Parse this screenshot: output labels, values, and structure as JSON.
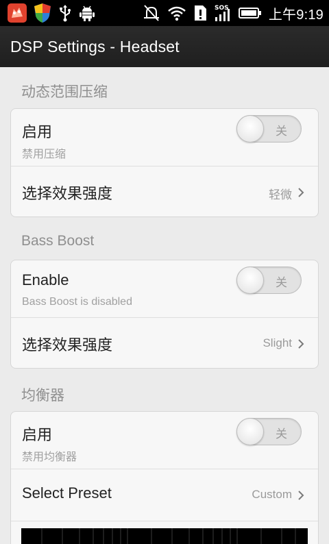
{
  "status_bar": {
    "time": "上午9:19",
    "icons": [
      "app-icon",
      "shield-icon",
      "usb-icon",
      "android-debug-icon",
      "vibrate-off-icon",
      "wifi-icon",
      "alert-icon",
      "sos-signal-icon",
      "battery-icon"
    ]
  },
  "title_bar": {
    "title": "DSP Settings - Headset"
  },
  "sections": [
    {
      "header": "动态范围压缩",
      "toggle_row": {
        "title": "启用",
        "subtitle": "禁用压缩",
        "toggle_label": "关",
        "toggle_on": false
      },
      "select_row": {
        "title": "选择效果强度",
        "value": "轻微"
      }
    },
    {
      "header": "Bass Boost",
      "toggle_row": {
        "title": "Enable",
        "subtitle": "Bass Boost is disabled",
        "toggle_label": "关",
        "toggle_on": false
      },
      "select_row": {
        "title": "选择效果强度",
        "value": "Slight"
      }
    },
    {
      "header": "均衡器",
      "toggle_row": {
        "title": "启用",
        "subtitle": "禁用均衡器",
        "toggle_label": "关",
        "toggle_on": false
      },
      "select_row": {
        "title": "Select Preset",
        "value": "Custom"
      }
    }
  ],
  "colors": {
    "background": "#ebebeb",
    "card": "#f7f7f7",
    "title_bar": "#222222",
    "status_bar": "#000000"
  }
}
